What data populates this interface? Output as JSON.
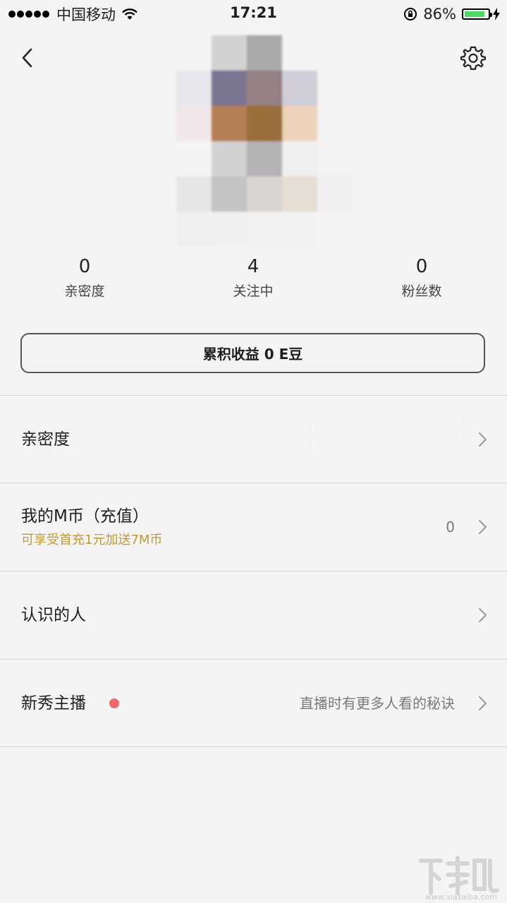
{
  "status_bar": {
    "carrier": "中国移动",
    "time": "17:21",
    "battery": "86%",
    "battery_level": 0.86
  },
  "stats": [
    {
      "value": "0",
      "label": "亲密度"
    },
    {
      "value": "4",
      "label": "关注中"
    },
    {
      "value": "0",
      "label": "粉丝数"
    }
  ],
  "earnings_button": "累积收益 0 E豆",
  "list": {
    "intimacy": {
      "title": "亲密度"
    },
    "mcoin": {
      "title": "我的M币（充值）",
      "subtitle": "可享受首充1元加送7M币",
      "value": "0"
    },
    "acquaintances": {
      "title": "认识的人"
    },
    "new_host": {
      "title": "新秀主播",
      "value": "直播时有更多人看的秘诀"
    }
  },
  "colors": {
    "background": "#f4f4f4",
    "promo_text": "#c39a2b",
    "badge_dot": "#ee6a6a",
    "battery": "#4cd964"
  },
  "icons": [
    "back-arrow-icon",
    "gear-icon",
    "chevron-right-icon",
    "wifi-icon",
    "lock-rotation-icon",
    "charging-bolt-icon"
  ],
  "watermark": {
    "text": "下载吧",
    "url": "www.xiazaiba.com"
  }
}
